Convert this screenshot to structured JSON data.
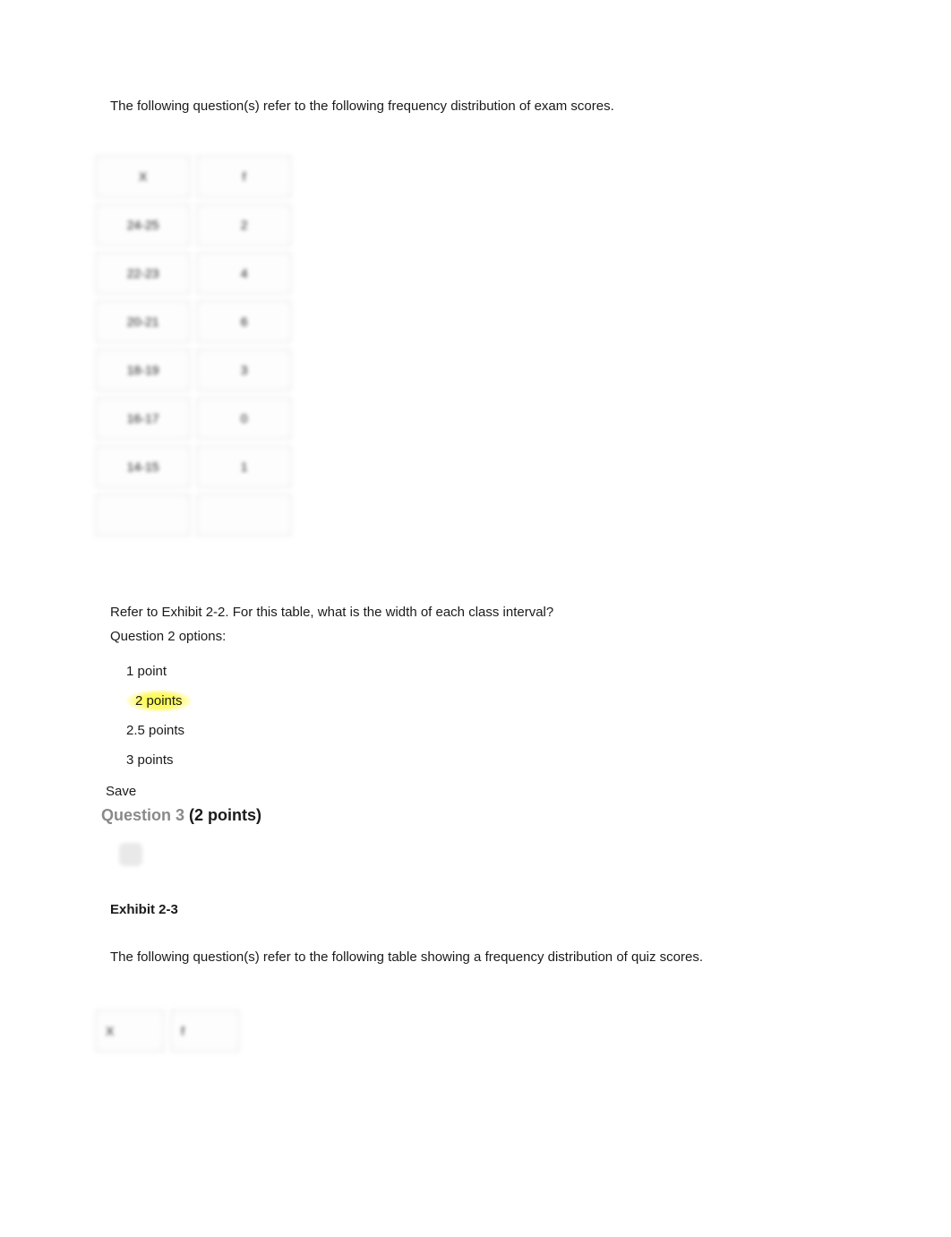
{
  "intro1": "The following question(s) refer to the following frequency distribution of exam scores.",
  "table1": {
    "header": {
      "x": "X",
      "f": "f"
    },
    "rows": [
      {
        "x": "24-25",
        "f": "2"
      },
      {
        "x": "22-23",
        "f": "4"
      },
      {
        "x": "20-21",
        "f": "6"
      },
      {
        "x": "18-19",
        "f": "3"
      },
      {
        "x": "16-17",
        "f": "0"
      },
      {
        "x": "14-15",
        "f": "1"
      },
      {
        "x": "",
        "f": ""
      }
    ]
  },
  "question2": {
    "prompt": "Refer to Exhibit 2-2. For this table, what is the width of each class interval?",
    "options_label": "Question 2 options:",
    "options": [
      {
        "text": "1 point",
        "highlight": false
      },
      {
        "text": "2 points",
        "highlight": true
      },
      {
        "text": "2.5 points",
        "highlight": false
      },
      {
        "text": "3 points",
        "highlight": false
      }
    ],
    "save": "Save"
  },
  "question3": {
    "heading_num": "Question 3 ",
    "heading_pts": "(2 points)",
    "exhibit_title": "Exhibit 2-3",
    "intro": "The following question(s) refer to the following table showing a frequency distribution of quiz scores."
  },
  "table2": {
    "header": {
      "x": "X",
      "f": "f"
    }
  }
}
